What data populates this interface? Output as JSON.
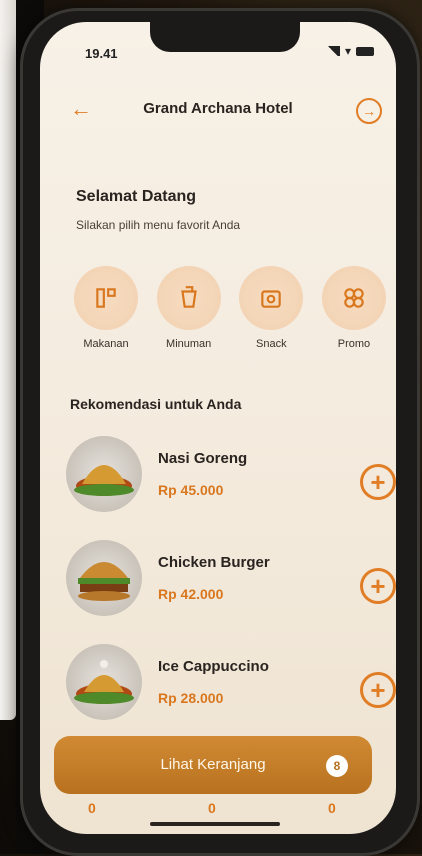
{
  "status": {
    "time": "19.41"
  },
  "header": {
    "title": "Grand Archana Hotel",
    "back_icon": "arrow-left-icon",
    "exit_icon": "logout-icon"
  },
  "welcome": {
    "title": "Selamat Datang",
    "subtitle": "Silakan pilih menu favorit Anda"
  },
  "categories": [
    {
      "label": "Makanan",
      "icon": "food-icon"
    },
    {
      "label": "Minuman",
      "icon": "drink-icon"
    },
    {
      "label": "Snack",
      "icon": "snack-icon"
    },
    {
      "label": "Promo",
      "icon": "promo-icon"
    }
  ],
  "recommend": {
    "title": "Rekomendasi untuk Anda",
    "items": [
      {
        "name": "Nasi Goreng",
        "price": "Rp 45.000"
      },
      {
        "name": "Chicken Burger",
        "price": "Rp 42.000"
      },
      {
        "name": "Ice Cappuccino",
        "price": "Rp 28.000"
      }
    ]
  },
  "cart": {
    "label": "Lihat Keranjang",
    "count": "8"
  },
  "bottom_nav": [
    "0",
    "0",
    "0"
  ],
  "colors": {
    "accent": "#e07d25",
    "cart_bg": "#c07a26",
    "background": "#f5ede0"
  }
}
